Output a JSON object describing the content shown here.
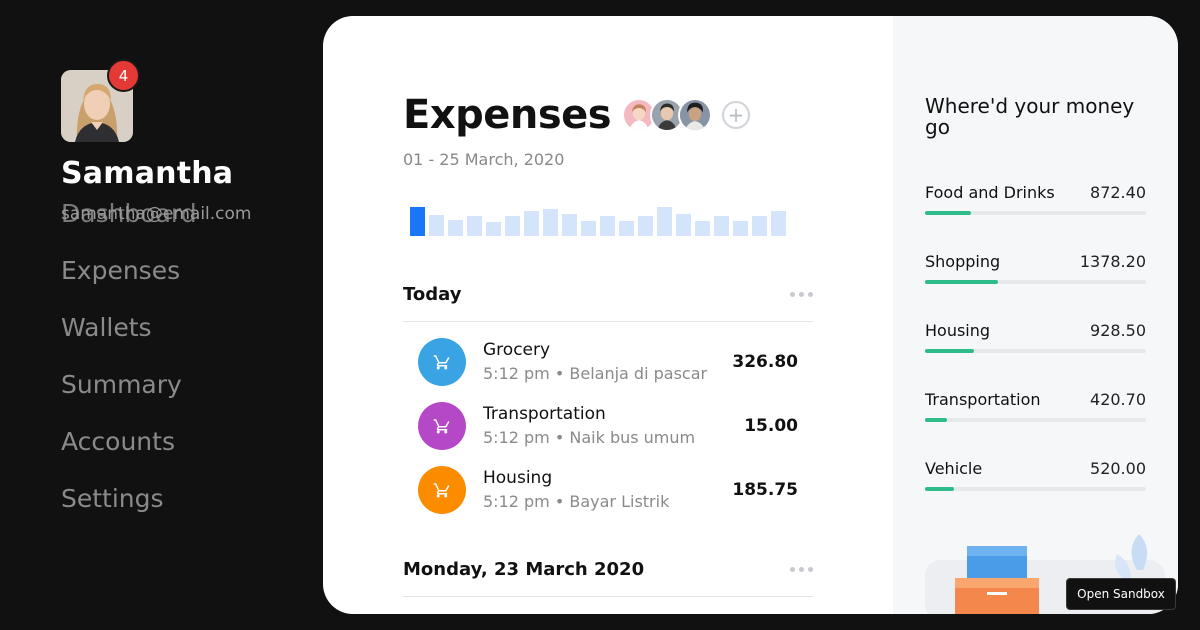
{
  "sidebar": {
    "notifications": "4",
    "user_name": "Samantha",
    "user_email": "samantha@email.com",
    "nav": [
      {
        "label": "Dashboard"
      },
      {
        "label": "Expenses"
      },
      {
        "label": "Wallets"
      },
      {
        "label": "Summary"
      },
      {
        "label": "Accounts"
      },
      {
        "label": "Settings"
      }
    ]
  },
  "main": {
    "title": "Expenses",
    "date_range": "01 - 25 March, 2020",
    "add_member_icon": "plus-circle-icon",
    "sections": [
      {
        "title": "Today",
        "transactions": [
          {
            "name": "Grocery",
            "meta": "5:12 pm • Belanja di pascar",
            "amount": "326.80",
            "icon": "cart-icon",
            "color": "#3aa3e3"
          },
          {
            "name": "Transportation",
            "meta": "5:12 pm • Naik bus umum",
            "amount": "15.00",
            "icon": "cart-icon",
            "color": "#b548c6"
          },
          {
            "name": "Housing",
            "meta": "5:12 pm • Bayar Listrik",
            "amount": "185.75",
            "icon": "cart-icon",
            "color": "#fb8c00"
          }
        ]
      },
      {
        "title": "Monday, 23 March 2020",
        "transactions": []
      }
    ],
    "accent_color": "#1976f6",
    "bar_color": "#d4e4fb"
  },
  "right_panel": {
    "title": "Where'd your money go",
    "categories": [
      {
        "name": "Food and Drinks",
        "value": "872.40",
        "share": 0.21
      },
      {
        "name": "Shopping",
        "value": "1378.20",
        "share": 0.33
      },
      {
        "name": "Housing",
        "value": "928.50",
        "share": 0.22
      },
      {
        "name": "Transportation",
        "value": "420.70",
        "share": 0.1
      },
      {
        "name": "Vehicle",
        "value": "520.00",
        "share": 0.13
      }
    ],
    "fill_color": "#2ebd8a"
  },
  "sandbox_label": "Open Sandbox"
}
